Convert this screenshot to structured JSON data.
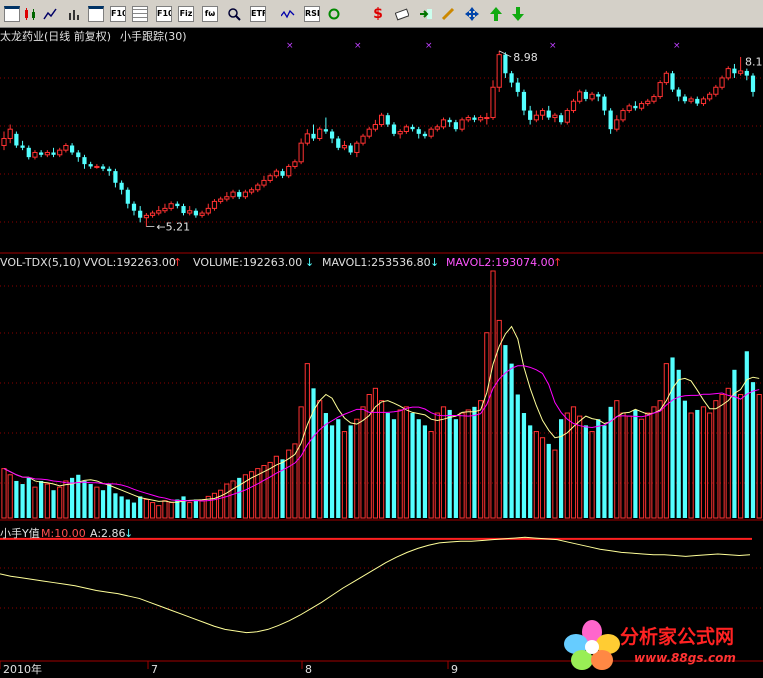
{
  "toolbar": {
    "buttons": [
      {
        "name": "new-window-icon",
        "text": ""
      },
      {
        "name": "candlestick-chart-icon",
        "text": ""
      },
      {
        "name": "line-chart-icon",
        "text": ""
      },
      {
        "name": "bar-chart-icon",
        "text": ""
      },
      {
        "name": "window-list-icon",
        "text": ""
      },
      {
        "name": "f10-button",
        "text": "F10"
      },
      {
        "name": "grid-icon",
        "text": ""
      },
      {
        "name": "f10-text-button",
        "text": "F10"
      },
      {
        "name": "fiz-button",
        "text": "Fiz"
      },
      {
        "name": "formula-icon",
        "text": "fω"
      },
      {
        "name": "search-icon",
        "text": ""
      },
      {
        "name": "etf-button",
        "text": "ETF"
      },
      {
        "name": "wave-icon",
        "text": ""
      },
      {
        "name": "rsi-button",
        "text": "RSI"
      },
      {
        "name": "refresh-icon",
        "text": ""
      },
      {
        "name": "dollar-icon",
        "text": "$"
      },
      {
        "name": "coupon-icon",
        "text": ""
      },
      {
        "name": "import-icon",
        "text": ""
      },
      {
        "name": "pencil-icon",
        "text": ""
      },
      {
        "name": "move-arrows-icon",
        "text": ""
      },
      {
        "name": "arrow-up-icon",
        "text": ""
      },
      {
        "name": "arrow-down-icon",
        "text": ""
      }
    ]
  },
  "price_panel": {
    "title": "太龙药业(日线 前复权)",
    "indicator": "小手跟踪(30)",
    "high_label": "8.98",
    "low_label": "5.21",
    "right_label": "8.1"
  },
  "volume_panel": {
    "name": "VOL-TDX(5,10)",
    "vvol": "VVOL:192263.00",
    "volume": "VOLUME:192263.00",
    "mavol1": "MAVOL1:253536.80",
    "mavol2": "MAVOL2:193074.00"
  },
  "y_panel": {
    "name": "小手Y值",
    "m": "M:10.00",
    "a": "A:2.86"
  },
  "x_axis": {
    "labels": [
      "2010年",
      "7",
      "8",
      "9"
    ]
  },
  "watermark": {
    "text": "分析家公式网",
    "url": "www.88gs.com"
  },
  "colors": {
    "up": "#ff3232",
    "down": "#54ffff",
    "grid": "#8b0000",
    "mavol1": "#ffff99",
    "mavol2": "#ff00ff",
    "yline": "#ffff99",
    "mline": "#ff2020"
  },
  "chart_data": {
    "type": "candlestick",
    "price": {
      "ylim": [
        4.9,
        9.3
      ],
      "candles": [
        [
          6.95,
          7.1,
          7.25,
          6.85
        ],
        [
          7.1,
          7.3,
          7.4,
          7.0
        ],
        [
          7.2,
          6.95,
          7.25,
          6.9
        ],
        [
          6.95,
          6.9,
          7.05,
          6.85
        ],
        [
          6.9,
          6.7,
          6.95,
          6.65
        ],
        [
          6.7,
          6.8,
          6.85,
          6.65
        ],
        [
          6.8,
          6.75,
          6.85,
          6.7
        ],
        [
          6.75,
          6.8,
          6.85,
          6.7
        ],
        [
          6.8,
          6.75,
          6.9,
          6.7
        ],
        [
          6.75,
          6.85,
          6.9,
          6.7
        ],
        [
          6.85,
          6.95,
          7.0,
          6.8
        ],
        [
          6.95,
          6.8,
          7.0,
          6.75
        ],
        [
          6.8,
          6.7,
          6.85,
          6.6
        ],
        [
          6.7,
          6.55,
          6.75,
          6.45
        ],
        [
          6.55,
          6.5,
          6.6,
          6.45
        ],
        [
          6.5,
          6.5,
          6.55,
          6.45
        ],
        [
          6.5,
          6.45,
          6.55,
          6.4
        ],
        [
          6.45,
          6.4,
          6.5,
          6.3
        ],
        [
          6.4,
          6.15,
          6.45,
          6.05
        ],
        [
          6.15,
          6.0,
          6.2,
          5.9
        ],
        [
          6.0,
          5.7,
          6.05,
          5.6
        ],
        [
          5.7,
          5.55,
          5.75,
          5.45
        ],
        [
          5.55,
          5.4,
          5.65,
          5.3
        ],
        [
          5.4,
          5.45,
          5.5,
          5.21
        ],
        [
          5.45,
          5.5,
          5.55,
          5.4
        ],
        [
          5.5,
          5.55,
          5.65,
          5.45
        ],
        [
          5.55,
          5.6,
          5.7,
          5.5
        ],
        [
          5.6,
          5.7,
          5.75,
          5.55
        ],
        [
          5.7,
          5.65,
          5.75,
          5.6
        ],
        [
          5.65,
          5.5,
          5.7,
          5.45
        ],
        [
          5.5,
          5.55,
          5.65,
          5.45
        ],
        [
          5.55,
          5.45,
          5.6,
          5.4
        ],
        [
          5.45,
          5.5,
          5.55,
          5.4
        ],
        [
          5.5,
          5.6,
          5.7,
          5.45
        ],
        [
          5.6,
          5.75,
          5.8,
          5.55
        ],
        [
          5.75,
          5.8,
          5.85,
          5.7
        ],
        [
          5.8,
          5.85,
          5.95,
          5.75
        ],
        [
          5.85,
          5.95,
          6.0,
          5.8
        ],
        [
          5.95,
          5.85,
          6.0,
          5.8
        ],
        [
          5.85,
          5.95,
          6.0,
          5.8
        ],
        [
          5.95,
          6.0,
          6.05,
          5.9
        ],
        [
          6.0,
          6.1,
          6.15,
          5.95
        ],
        [
          6.1,
          6.2,
          6.3,
          6.05
        ],
        [
          6.2,
          6.3,
          6.35,
          6.15
        ],
        [
          6.3,
          6.4,
          6.45,
          6.25
        ],
        [
          6.4,
          6.3,
          6.45,
          6.25
        ],
        [
          6.3,
          6.5,
          6.55,
          6.25
        ],
        [
          6.5,
          6.6,
          6.65,
          6.45
        ],
        [
          6.6,
          7.0,
          7.1,
          6.55
        ],
        [
          7.0,
          7.2,
          7.3,
          6.95
        ],
        [
          7.2,
          7.1,
          7.4,
          7.05
        ],
        [
          7.1,
          7.3,
          7.35,
          7.05
        ],
        [
          7.3,
          7.25,
          7.55,
          7.2
        ],
        [
          7.25,
          7.1,
          7.3,
          7.0
        ],
        [
          7.1,
          6.9,
          7.15,
          6.85
        ],
        [
          6.9,
          6.95,
          7.05,
          6.85
        ],
        [
          6.95,
          6.8,
          7.0,
          6.75
        ],
        [
          6.8,
          7.0,
          7.05,
          6.7
        ],
        [
          7.0,
          7.15,
          7.2,
          6.95
        ],
        [
          7.15,
          7.3,
          7.35,
          7.1
        ],
        [
          7.3,
          7.4,
          7.5,
          7.25
        ],
        [
          7.4,
          7.6,
          7.65,
          7.35
        ],
        [
          7.6,
          7.4,
          7.65,
          7.35
        ],
        [
          7.4,
          7.2,
          7.45,
          7.15
        ],
        [
          7.2,
          7.25,
          7.3,
          7.1
        ],
        [
          7.25,
          7.35,
          7.4,
          7.2
        ],
        [
          7.35,
          7.3,
          7.4,
          7.25
        ],
        [
          7.3,
          7.2,
          7.35,
          7.1
        ],
        [
          7.2,
          7.15,
          7.25,
          7.1
        ],
        [
          7.15,
          7.3,
          7.35,
          7.1
        ],
        [
          7.3,
          7.35,
          7.4,
          7.25
        ],
        [
          7.35,
          7.5,
          7.55,
          7.3
        ],
        [
          7.5,
          7.45,
          7.55,
          7.35
        ],
        [
          7.45,
          7.3,
          7.5,
          7.25
        ],
        [
          7.3,
          7.5,
          7.55,
          7.25
        ],
        [
          7.5,
          7.55,
          7.6,
          7.45
        ],
        [
          7.55,
          7.5,
          7.6,
          7.45
        ],
        [
          7.5,
          7.55,
          7.6,
          7.45
        ],
        [
          7.55,
          7.55,
          7.65,
          7.4
        ],
        [
          7.55,
          8.2,
          8.35,
          7.5
        ],
        [
          8.2,
          8.9,
          8.98,
          8.1
        ],
        [
          8.9,
          8.5,
          8.95,
          8.4
        ],
        [
          8.5,
          8.3,
          8.55,
          8.2
        ],
        [
          8.3,
          8.1,
          8.4,
          8.0
        ],
        [
          8.1,
          7.7,
          8.15,
          7.6
        ],
        [
          7.7,
          7.5,
          7.8,
          7.4
        ],
        [
          7.5,
          7.6,
          7.7,
          7.45
        ],
        [
          7.6,
          7.7,
          7.75,
          7.5
        ],
        [
          7.7,
          7.55,
          7.8,
          7.5
        ],
        [
          7.55,
          7.6,
          7.65,
          7.45
        ],
        [
          7.6,
          7.45,
          7.65,
          7.4
        ],
        [
          7.45,
          7.7,
          7.75,
          7.4
        ],
        [
          7.7,
          7.9,
          7.95,
          7.65
        ],
        [
          7.9,
          8.1,
          8.15,
          7.85
        ],
        [
          8.1,
          7.95,
          8.15,
          7.9
        ],
        [
          7.95,
          8.05,
          8.1,
          7.9
        ],
        [
          8.05,
          8.0,
          8.1,
          7.9
        ],
        [
          8.0,
          7.7,
          8.05,
          7.6
        ],
        [
          7.7,
          7.3,
          7.75,
          7.2
        ],
        [
          7.3,
          7.5,
          7.6,
          7.25
        ],
        [
          7.5,
          7.7,
          7.75,
          7.45
        ],
        [
          7.7,
          7.8,
          7.85,
          7.65
        ],
        [
          7.8,
          7.75,
          7.9,
          7.7
        ],
        [
          7.75,
          7.85,
          7.9,
          7.7
        ],
        [
          7.85,
          7.9,
          7.95,
          7.8
        ],
        [
          7.9,
          8.0,
          8.05,
          7.85
        ],
        [
          8.0,
          8.3,
          8.35,
          7.95
        ],
        [
          8.3,
          8.5,
          8.55,
          8.25
        ],
        [
          8.5,
          8.15,
          8.55,
          8.1
        ],
        [
          8.15,
          8.0,
          8.2,
          7.9
        ],
        [
          8.0,
          7.9,
          8.05,
          7.85
        ],
        [
          7.9,
          7.95,
          8.0,
          7.85
        ],
        [
          7.95,
          7.85,
          8.0,
          7.8
        ],
        [
          7.85,
          7.95,
          8.0,
          7.8
        ],
        [
          7.95,
          8.05,
          8.1,
          7.9
        ],
        [
          8.05,
          8.2,
          8.25,
          8.0
        ],
        [
          8.2,
          8.4,
          8.45,
          8.15
        ],
        [
          8.4,
          8.6,
          8.65,
          8.35
        ],
        [
          8.6,
          8.5,
          8.7,
          8.4
        ],
        [
          8.5,
          8.55,
          8.85,
          8.45
        ],
        [
          8.55,
          8.45,
          8.6,
          8.35
        ],
        [
          8.45,
          8.1,
          8.5,
          8.0
        ]
      ]
    },
    "volume": {
      "ylim": [
        0,
        400000
      ],
      "values": [
        80,
        70,
        60,
        55,
        65,
        50,
        60,
        55,
        45,
        50,
        60,
        65,
        70,
        60,
        55,
        50,
        45,
        55,
        40,
        35,
        30,
        25,
        35,
        30,
        25,
        20,
        28,
        25,
        30,
        35,
        25,
        30,
        28,
        35,
        40,
        45,
        55,
        60,
        65,
        70,
        75,
        80,
        85,
        90,
        100,
        95,
        110,
        120,
        180,
        250,
        210,
        190,
        170,
        150,
        160,
        140,
        150,
        160,
        180,
        200,
        210,
        190,
        170,
        160,
        175,
        180,
        170,
        160,
        150,
        140,
        170,
        180,
        175,
        160,
        170,
        175,
        180,
        190,
        300,
        400,
        320,
        280,
        250,
        200,
        170,
        150,
        140,
        130,
        120,
        110,
        160,
        170,
        180,
        165,
        150,
        140,
        160,
        150,
        180,
        190,
        170,
        165,
        175,
        160,
        170,
        180,
        190,
        250,
        260,
        240,
        190,
        170,
        175,
        180,
        170,
        190,
        200,
        210,
        240,
        200,
        270,
        220,
        200
      ]
    },
    "y_value": {
      "ylim": [
        -5,
        12
      ],
      "m_line": 10,
      "values": [
        5.6,
        5.3,
        5.1,
        4.9,
        4.7,
        4.5,
        4.3,
        4.1,
        3.8,
        3.5,
        3.3,
        3.1,
        2.8,
        2.5,
        2.0,
        1.5,
        1.0,
        0.5,
        0.0,
        -0.5,
        -1.0,
        -1.4,
        -1.6,
        -1.8,
        -1.7,
        -1.4,
        -0.9,
        -0.3,
        0.4,
        1.2,
        2.0,
        2.9,
        3.8,
        4.6,
        5.4,
        6.2,
        7.0,
        7.7,
        8.3,
        8.8,
        9.2,
        9.5,
        9.6,
        9.7,
        9.7,
        9.8,
        9.9,
        10.0,
        10.1,
        10.2,
        10.1,
        10.0,
        9.9,
        9.6,
        9.3,
        9.0,
        8.7,
        8.5,
        8.3,
        8.2,
        8.1,
        8.0,
        8.0,
        7.9,
        7.8,
        7.9,
        8.0,
        8.1,
        8.0,
        7.9,
        8.0
      ]
    }
  }
}
